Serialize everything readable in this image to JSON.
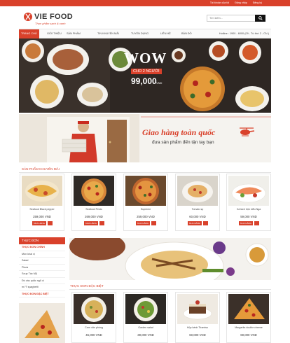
{
  "topbar": {
    "links": [
      "Tài khoản của tôi",
      "Đăng nhập",
      "Đăng ký"
    ]
  },
  "header": {
    "brand": "VIE FOOD",
    "tagline": "Thực phẩm sạch & xanh",
    "search_placeholder": "Tìm kiếm...",
    "accent": "#d9412b"
  },
  "nav": {
    "items": [
      "TRANG CHỦ",
      "GIỚI THIỆU",
      "SẢN PHẨM",
      "TIN KHUYẾN MÃI",
      "TUYỂN DỤNG",
      "LIÊN HỆ",
      "BẢN ĐỒ"
    ],
    "hotline": "Hotline : 1900 - 6000 (09 - Từ thứ 2 - CN )"
  },
  "banner": {
    "headline": "WOW",
    "sub": "CHO 2 NGƯỜI",
    "price": "99,000",
    "currency": "VND"
  },
  "delivery": {
    "title": "Giao hàng toàn quốc",
    "subtitle": "đưa sản phẩm đến tận tay bạn"
  },
  "promo": {
    "title": "SẢN PHẨM KHUYẾN MÃI",
    "buy_label": "MUA HÀNG",
    "items": [
      {
        "name": "Seafood Black pepper",
        "price": "259,000 VND"
      },
      {
        "name": "Seafood Pesto",
        "price": "269,000 VND"
      },
      {
        "name": "Supreme",
        "price": "259,000 VND"
      },
      {
        "name": "Tomato sp",
        "price": "60,000 VND"
      },
      {
        "name": "Xá lách trộn kiểu Nga",
        "price": "59,000 VND"
      }
    ]
  },
  "sidebar": {
    "title": "THỰC ĐƠN",
    "items": [
      "THỰC ĐƠN CHÍNH",
      "Món khai vị",
      "Salad",
      "Pizza",
      "Soup Tác Mỹ",
      "Đồ cầu quắc ngũ vị",
      "mì Ý spaghetti",
      "THỰC ĐƠN ĐẶC BIỆT"
    ]
  },
  "special": {
    "title": "THỰC ĐƠN ĐẶC BIỆT",
    "items": [
      {
        "name": "Cơm văn phòng",
        "price": "45,000 VND"
      },
      {
        "name": "Garden salad",
        "price": "39,000 VND"
      },
      {
        "name": "Hộp bánh Tiramisu",
        "price": "60,000 VND"
      },
      {
        "name": "Margarita double cheese",
        "price": "69,000 VND"
      }
    ]
  }
}
